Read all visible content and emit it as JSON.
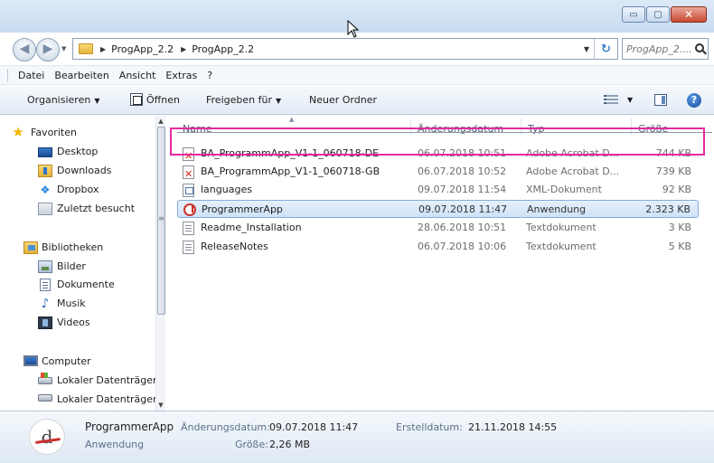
{
  "window": {
    "minimize_glyph": "▭",
    "maximize_glyph": "▢",
    "close_glyph": "✕"
  },
  "address": {
    "crumbs": [
      "ProgApp_2.2",
      "ProgApp_2.2"
    ],
    "separator": "▶",
    "search_placeholder": "ProgApp_2...."
  },
  "menu": [
    "Datei",
    "Bearbeiten",
    "Ansicht",
    "Extras",
    "?"
  ],
  "toolbar": {
    "organize": "Organisieren",
    "open": "Öffnen",
    "share": "Freigeben für",
    "new_folder": "Neuer Ordner",
    "help": "?"
  },
  "navigation": {
    "favorites": {
      "label": "Favoriten",
      "items": [
        "Desktop",
        "Downloads",
        "Dropbox",
        "Zuletzt besucht"
      ]
    },
    "libraries": {
      "label": "Bibliotheken",
      "items": [
        "Bilder",
        "Dokumente",
        "Musik",
        "Videos"
      ]
    },
    "computer": {
      "label": "Computer",
      "items": [
        "Lokaler Datenträger",
        "Lokaler Datenträger"
      ]
    }
  },
  "columns": {
    "name": "Name",
    "date": "Änderungsdatum",
    "type": "Typ",
    "size": "Größe"
  },
  "files": [
    {
      "name": "BA_ProgrammApp_V1-1_060718-DE",
      "date": "06.07.2018 10:51",
      "type": "Adobe Acrobat D...",
      "size": "744 KB",
      "icon": "pdf-icon"
    },
    {
      "name": "BA_ProgrammApp_V1-1_060718-GB",
      "date": "06.07.2018 10:52",
      "type": "Adobe Acrobat D...",
      "size": "739 KB",
      "icon": "pdf-icon"
    },
    {
      "name": "languages",
      "date": "09.07.2018 11:54",
      "type": "XML-Dokument",
      "size": "92 KB",
      "icon": "xml-icon"
    },
    {
      "name": "ProgrammerApp",
      "date": "09.07.2018 11:47",
      "type": "Anwendung",
      "size": "2.323 KB",
      "icon": "app-icon",
      "selected": true
    },
    {
      "name": "Readme_Installation",
      "date": "28.06.2018 10:51",
      "type": "Textdokument",
      "size": "3 KB",
      "icon": "txt-icon"
    },
    {
      "name": "ReleaseNotes",
      "date": "06.07.2018 10:06",
      "type": "Textdokument",
      "size": "5 KB",
      "icon": "txt-icon"
    }
  ],
  "details": {
    "icon_letter": "d",
    "name": "ProgrammerApp",
    "kind": "Anwendung",
    "modified_label": "Änderungsdatum:",
    "modified_value": "09.07.2018 11:47",
    "created_label": "Erstelldatum:",
    "created_value": "21.11.2018 14:55",
    "size_label": "Größe:",
    "size_value": "2,26 MB"
  },
  "colors": {
    "highlight": "#e62a9c",
    "selection": "#cfe2f8"
  }
}
